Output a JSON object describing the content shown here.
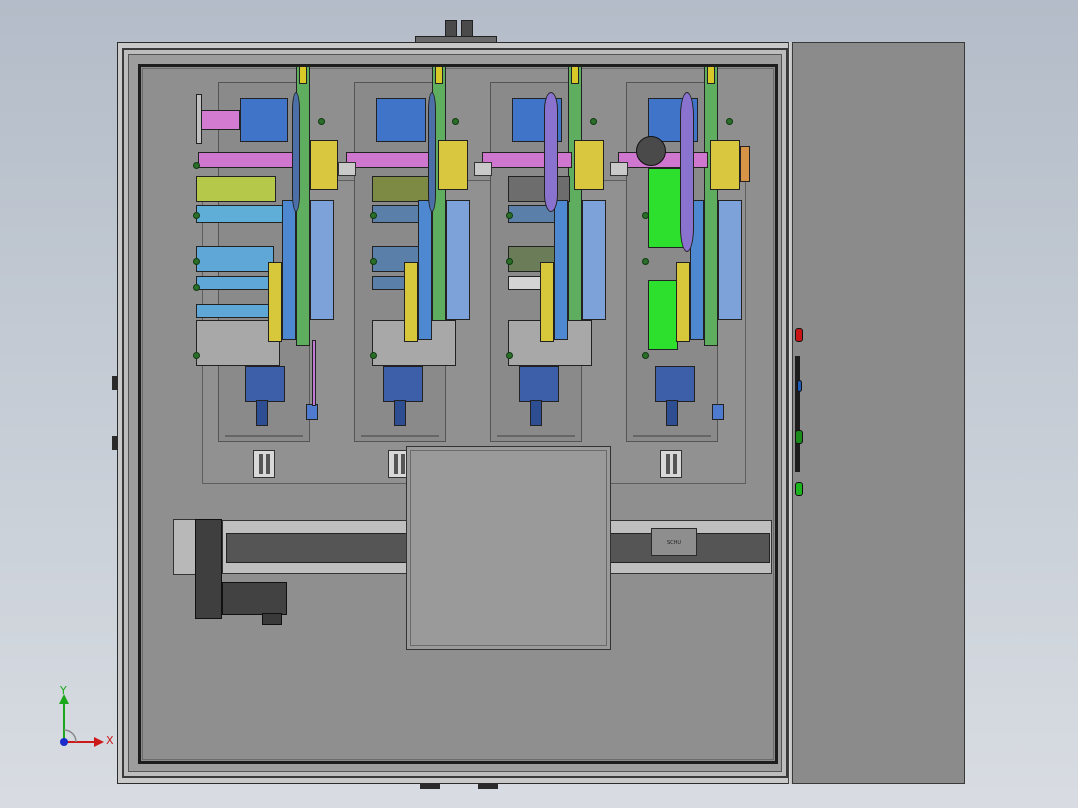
{
  "viewport": {
    "view": "top view",
    "background_top": "#b3bcc8",
    "background_bottom": "#d8dce2"
  },
  "axis_triad": {
    "x_label": "X",
    "y_label": "Y",
    "x_color": "#cc1a1a",
    "y_color": "#1aa81a",
    "origin_color": "#1a2ccc"
  },
  "machine": {
    "module_count": 4,
    "frame_color": "#c9c9c9",
    "side_cabinet_color": "#8b8b8b",
    "indicator_colors": [
      "#c81414",
      "#1a8a1a",
      "#1db51d",
      "#1f5bb8"
    ]
  },
  "rail_label": {
    "text": "SCHU"
  }
}
